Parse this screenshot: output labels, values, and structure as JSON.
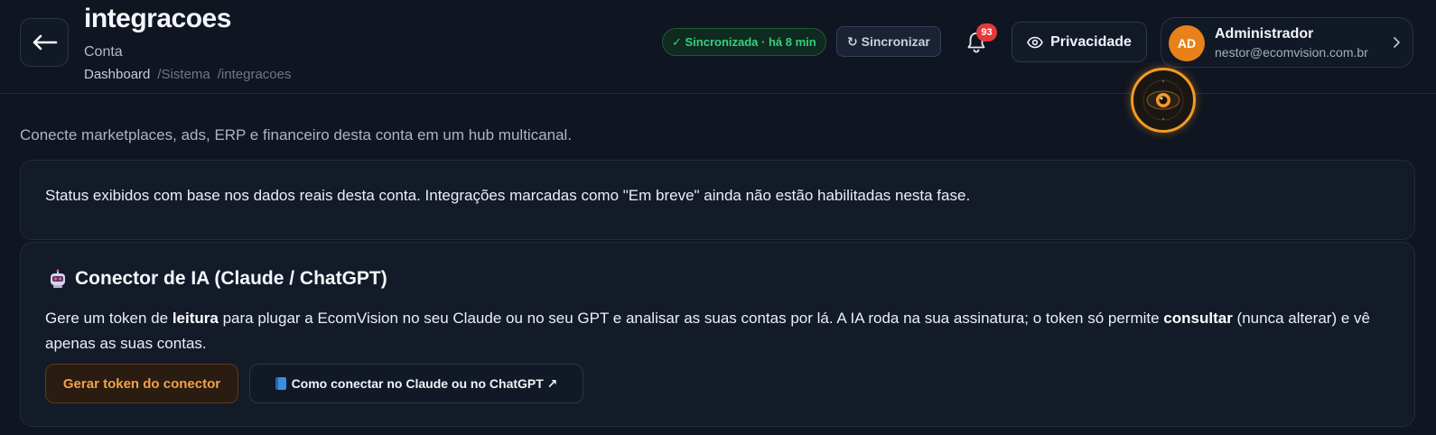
{
  "header": {
    "title": "integracoes",
    "subtitle": "Conta",
    "breadcrumb": [
      "Dashboard",
      "/Sistema",
      "/integracoes"
    ],
    "sync_status": "✓ Sincronizada · há 8 min",
    "sync_button": "↻ Sincronizar",
    "notification_count": "93",
    "privacy_button": "Privacidade",
    "user": {
      "initials": "AD",
      "name": "Administrador",
      "email": "nestor@ecomvision.com.br"
    }
  },
  "intro": "Conecte marketplaces, ads, ERP e financeiro desta conta em um hub multicanal.",
  "notice": "Status exibidos com base nos dados reais desta conta. Integrações marcadas como \"Em breve\" ainda não estão habilitadas nesta fase.",
  "ai_connector": {
    "icon": "robot-icon",
    "title": "Conector de IA (Claude / ChatGPT)",
    "desc_1": "Gere um token de ",
    "desc_bold_1": "leitura",
    "desc_2": " para plugar a EcomVision no seu Claude ou no seu GPT e analisar as suas contas por lá. A IA roda na sua assinatura; o token só permite ",
    "desc_bold_2": "consultar",
    "desc_3": " (nunca alterar) e vê apenas as suas contas.",
    "primary_button": "Gerar token do conector",
    "secondary_button": "Como conectar no Claude ou no ChatGPT ↗"
  },
  "colors": {
    "background": "#0f1521",
    "accent": "#f39a25",
    "success": "#35d07f",
    "badge": "#e53a3a"
  }
}
